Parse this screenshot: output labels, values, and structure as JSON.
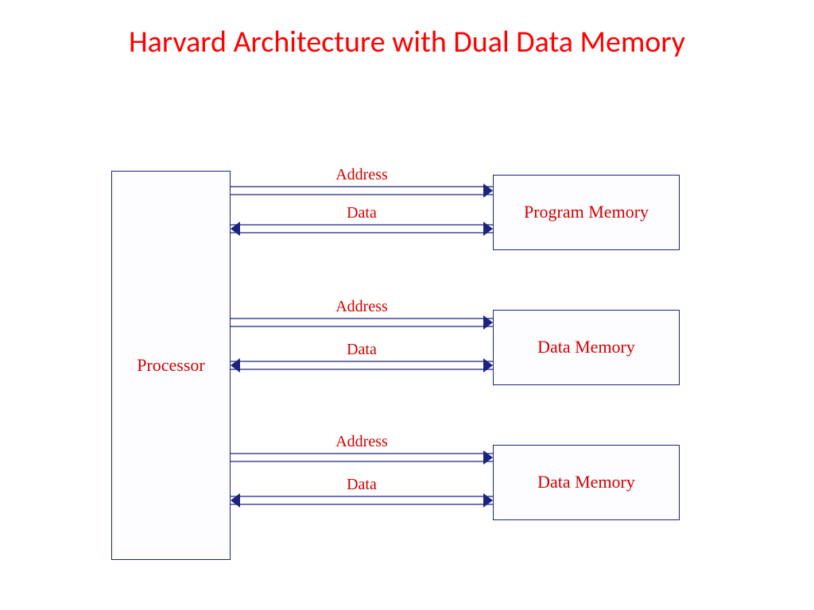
{
  "title": "Harvard Architecture with Dual Data Memory",
  "diagram": {
    "processor_label": "Processor",
    "memories": [
      {
        "label": "Program Memory"
      },
      {
        "label": "Data Memory"
      },
      {
        "label": "Data Memory"
      }
    ],
    "bus_labels": {
      "address": "Address",
      "data": "Data"
    }
  }
}
